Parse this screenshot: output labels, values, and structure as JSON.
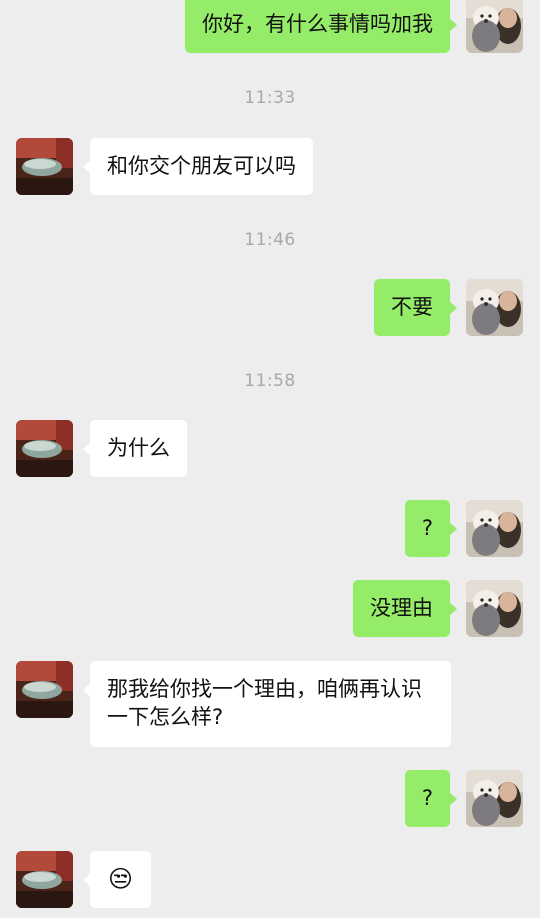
{
  "messages": [
    {
      "side": "right",
      "text": "你好，有什么事情吗加我"
    },
    {
      "time": "11:33"
    },
    {
      "side": "left",
      "text": "和你交个朋友可以吗"
    },
    {
      "time": "11:46"
    },
    {
      "side": "right",
      "text": "不要"
    },
    {
      "time": "11:58"
    },
    {
      "side": "left",
      "text": "为什么"
    },
    {
      "side": "right",
      "text": "?"
    },
    {
      "side": "right",
      "text": "没理由"
    },
    {
      "side": "left",
      "text": "那我给你找一个理由，咱俩再认识一下怎么样?"
    },
    {
      "side": "right",
      "text": "?"
    },
    {
      "side": "left",
      "emoji": "😒",
      "emoji_name": "unamused-face-emoji"
    }
  ],
  "colors": {
    "background": "#ededed",
    "outgoing_bubble": "#95ec69",
    "incoming_bubble": "#ffffff",
    "timestamp_text": "#a8a8a8"
  }
}
